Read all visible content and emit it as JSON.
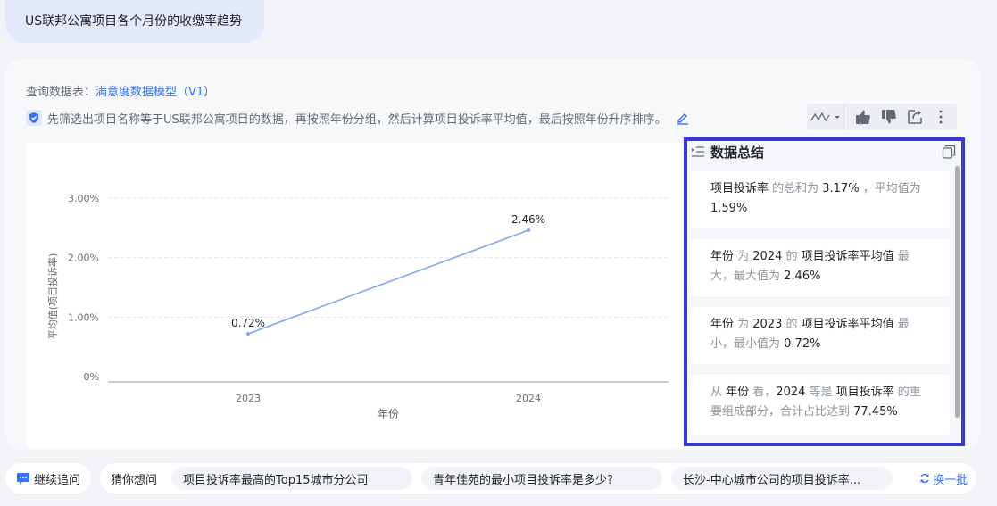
{
  "query": "US联邦公寓项目各个月份的收缴率趋势",
  "source": {
    "label": "查询数据表：",
    "table": "满意度数据模型（V1）"
  },
  "description": "先筛选出项目名称等于US联邦公寓项目的数据，再按照年份分组，然后计算项目投诉率平均值，最后按照年份升序排序。",
  "colors": {
    "accent": "#3370ff",
    "line": "#7aa5f0",
    "highlight_border": "#3838d4"
  },
  "chart_data": {
    "type": "line",
    "categories": [
      "2023",
      "2024"
    ],
    "values": [
      0.72,
      2.46
    ],
    "data_labels": [
      "0.72%",
      "2.46%"
    ],
    "xlabel": "年份",
    "ylabel": "平均值(项目投诉率)",
    "yticks": [
      "0%",
      "1.00%",
      "2.00%",
      "3.00%"
    ],
    "ylim": [
      0,
      3
    ],
    "grid": true
  },
  "summary": {
    "title": "数据总结",
    "cards": [
      {
        "parts": [
          [
            "项目投诉率",
            true
          ],
          [
            " 的总和为 ",
            false
          ],
          [
            "3.17%",
            true
          ],
          [
            " ，平均值为 ",
            false
          ],
          [
            "1.59%",
            true
          ]
        ]
      },
      {
        "parts": [
          [
            "年份",
            true
          ],
          [
            " 为 ",
            false
          ],
          [
            "2024",
            true
          ],
          [
            " 的 ",
            false
          ],
          [
            "项目投诉率平均值",
            true
          ],
          [
            " 最大，最大值为 ",
            false
          ],
          [
            "2.46%",
            true
          ]
        ]
      },
      {
        "parts": [
          [
            "年份",
            true
          ],
          [
            " 为 ",
            false
          ],
          [
            "2023",
            true
          ],
          [
            " 的 ",
            false
          ],
          [
            "项目投诉率平均值",
            true
          ],
          [
            " 最小，最小值为 ",
            false
          ],
          [
            "0.72%",
            true
          ]
        ]
      },
      {
        "parts": [
          [
            "从 ",
            false
          ],
          [
            "年份",
            true
          ],
          [
            " 看，",
            false
          ],
          [
            "2024",
            true
          ],
          [
            " 等是 ",
            false
          ],
          [
            "项目投诉率",
            true
          ],
          [
            " 的重要组成部分，合计占比达到 ",
            false
          ],
          [
            "77.45%",
            true
          ]
        ]
      }
    ]
  },
  "footer": {
    "follow": "继续追问",
    "guess_label": "猜你想问",
    "suggestions": [
      "项目投诉率最高的Top15城市分公司",
      "青年佳苑的最小项目投诉率是多少?",
      "长沙-中心城市公司的项目投诉率..."
    ],
    "refresh": "换一批"
  },
  "icons": [
    "shield-icon",
    "edit-icon",
    "line-chart-icon",
    "thumbs-up-icon",
    "thumbs-down-icon",
    "share-icon",
    "more-icon",
    "list-icon",
    "copy-icon",
    "chat-icon",
    "refresh-icon"
  ]
}
